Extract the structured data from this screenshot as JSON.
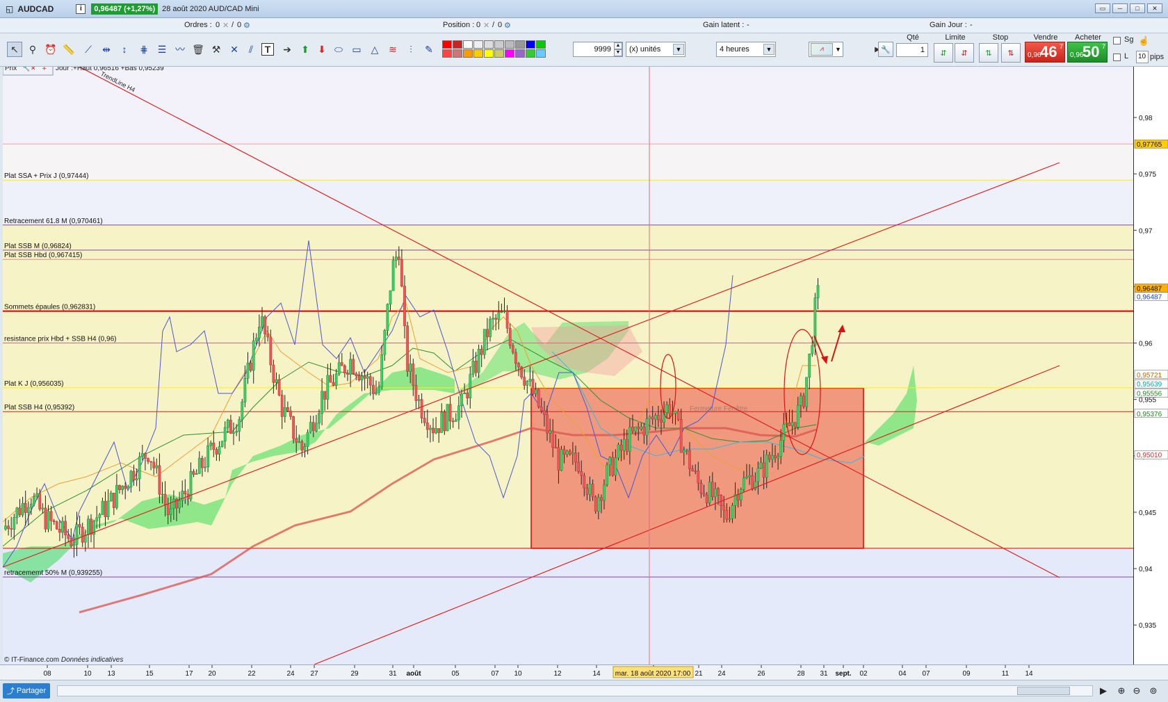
{
  "window": {
    "symbol": "AUDCAD",
    "info_icon": "i",
    "price_badge": "0,96487 (+1,27%)",
    "date_title": "28 août 2020 AUD/CAD Mini",
    "btn_restore": "▭",
    "btn_min": "─",
    "btn_max": "□",
    "btn_close": "✕"
  },
  "status": {
    "ordres_label": "Ordres :",
    "ordres_a": "0",
    "ordres_b": "0",
    "position_label": "Position :",
    "position_a": "0",
    "position_b": "0",
    "gain_latent_label": "Gain latent :",
    "gain_latent_value": "-",
    "gain_jour_label": "Gain Jour :",
    "gain_jour_value": "-"
  },
  "toolbar": {
    "quantity": "9999",
    "unit_select": "(x) unités",
    "timeframe_select": "4 heures",
    "qte_label": "Qté",
    "qte_value": "1",
    "limite_label": "Limite",
    "stop_label": "Stop",
    "vendre_label": "Vendre",
    "acheter_label": "Acheter",
    "sell_small": "0,96",
    "sell_big": "46",
    "sell_sup": "7",
    "buy_small": "0,96",
    "buy_big": "50",
    "buy_sup": "7",
    "sg_label": "Sg",
    "l_label": "L",
    "pips_value": "10",
    "pips_label": "pips",
    "palette": [
      "#ff0000",
      "#cc2222",
      "#ffffff",
      "#eeeeee",
      "#dddddd",
      "#cccccc",
      "#bbbbbb",
      "#999999",
      "#0000ff",
      "#00cc00",
      "#ff4444",
      "#cc7777",
      "#ff9900",
      "#ffcc00",
      "#ffff00",
      "#cccc66",
      "#ff00ff",
      "#9966cc",
      "#33cc33",
      "#66ccff"
    ]
  },
  "chart_header": {
    "prix_label": "Prix",
    "ohlc_text": "Jour :+Haut 0,96516 +Bas 0,95239"
  },
  "chart_data": {
    "type": "candlestick",
    "instrument": "AUDCAD",
    "timeframe": "4 heures",
    "ylim": [
      0.9315,
      0.9845
    ],
    "price_ticks": [
      "0,98",
      "0,975",
      "0,97",
      "0,965",
      "0,96",
      "0,955",
      "0,95",
      "0,945",
      "0,94",
      "0,935"
    ],
    "price_tick_values": [
      0.98,
      0.975,
      0.97,
      0.965,
      0.96,
      0.955,
      0.95,
      0.945,
      0.94,
      0.935
    ],
    "price_tags": [
      {
        "value": 0.97765,
        "text": "0,97765",
        "bg": "#ffcc00"
      },
      {
        "value": 0.96487,
        "text": "0,96487",
        "bg": "#ffb000"
      },
      {
        "value": 0.96487,
        "text": "0,96487",
        "bg": "#ffffff",
        "fg": "#2244cc",
        "offset": 1
      },
      {
        "value": 0.95721,
        "text": "0,95721",
        "bg": "#ffffff",
        "fg": "#cc6600"
      },
      {
        "value": 0.95639,
        "text": "0,95639",
        "bg": "#ffffff",
        "fg": "#00aaaa"
      },
      {
        "value": 0.95556,
        "text": "0,95556",
        "bg": "#ffffff",
        "fg": "#228822"
      },
      {
        "value": 0.95376,
        "text": "0,95376",
        "bg": "#ffffff",
        "fg": "#228822"
      },
      {
        "value": 0.9501,
        "text": "0,95010",
        "bg": "#ffffff",
        "fg": "#cc3333"
      }
    ],
    "date_labels": [
      "08",
      "10",
      "13",
      "15",
      "17",
      "20",
      "22",
      "24",
      "27",
      "29",
      "31",
      "août",
      "05",
      "07",
      "10",
      "12",
      "14",
      "18",
      "21",
      "24",
      "26",
      "28",
      "31",
      "sept.",
      "02",
      "04",
      "07",
      "09",
      "11",
      "14"
    ],
    "crosshair_label": "mar. 18 août 2020 17:00",
    "horizontal_levels": [
      {
        "label": "Plat SSA + Prix J (0,97444)",
        "value": 0.97444,
        "color": "#ffee00"
      },
      {
        "label": "Retracement 61.8 M (0,970461)",
        "value": 0.970461,
        "color": "#8844aa"
      },
      {
        "label": "Plat SSB M (0,96824)",
        "value": 0.96824,
        "color": "#8844aa"
      },
      {
        "label": "Plat SSB Hbd (0,967415)",
        "value": 0.967415,
        "color": "#e08888"
      },
      {
        "label": "Sommets épaules (0,962831)",
        "value": 0.962831,
        "color": "#dd0000"
      },
      {
        "label": "resistance prix Hbd + SSB H4 (0,96)",
        "value": 0.96,
        "color": "#dd6688"
      },
      {
        "label": "Plat K J (0,956035)",
        "value": 0.956035,
        "color": "#ffee00"
      },
      {
        "label": "Plat SSB H4 (0,95392)",
        "value": 0.95392,
        "color": "#cc2222"
      },
      {
        "label": "retracememt 50% M (0,939255)",
        "value": 0.939255,
        "color": "#8844aa"
      }
    ],
    "trendline_label": "TrendLine H4",
    "watermark_text": "Fermeture Fenêtre",
    "footer_note": "© IT-Finance.com",
    "footer_note_italic": "Données indicatives",
    "kumo_color": "#3ddc5a",
    "range_box_color": "#ee7f6a"
  },
  "bottom": {
    "share_label": "Partager"
  }
}
